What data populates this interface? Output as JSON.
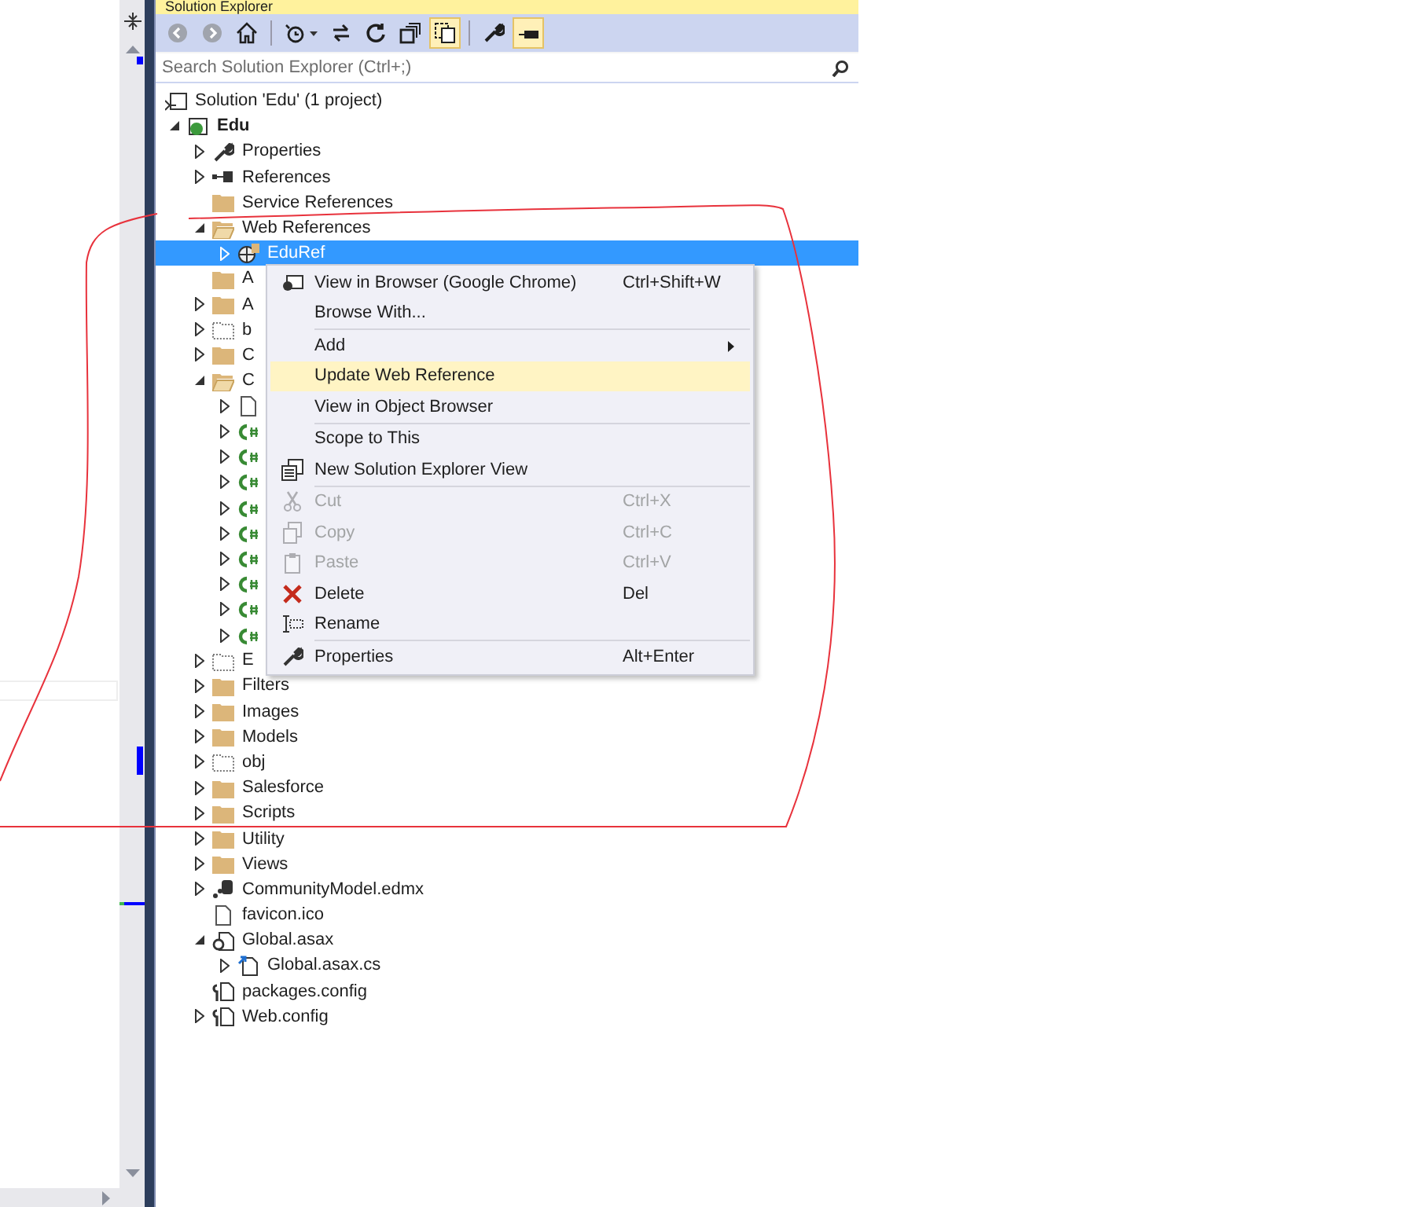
{
  "panel": {
    "title": "Solution Explorer",
    "search": {
      "placeholder": "Search Solution Explorer (Ctrl+;)"
    },
    "toolbar": [
      {
        "kind": "button",
        "disabled": true,
        "selected": false
      },
      {
        "kind": "button",
        "disabled": true,
        "selected": false
      },
      {
        "kind": "button",
        "disabled": false,
        "selected": false
      },
      {
        "kind": "separator"
      },
      {
        "kind": "button",
        "disabled": false,
        "selected": false,
        "dropdown": true
      },
      {
        "kind": "button",
        "disabled": false,
        "selected": false
      },
      {
        "kind": "button",
        "disabled": false,
        "selected": false
      },
      {
        "kind": "button",
        "disabled": false,
        "selected": false
      },
      {
        "kind": "button",
        "disabled": false,
        "selected": true
      },
      {
        "kind": "separator"
      },
      {
        "kind": "button",
        "disabled": false,
        "selected": false
      },
      {
        "kind": "button",
        "disabled": false,
        "selected": true
      }
    ],
    "tree": [
      {
        "label": "Solution 'Edu' (1 project)",
        "kind": "solution",
        "expandable": false,
        "selected": false,
        "children": [
          {
            "label": "Edu",
            "kind": "project",
            "expandable": true,
            "expanded": true,
            "selected": false,
            "children": [
              {
                "label": "Properties",
                "kind": "properties",
                "expandable": true,
                "expanded": false,
                "selected": false
              },
              {
                "label": "References",
                "kind": "references",
                "expandable": true,
                "expanded": false,
                "selected": false
              },
              {
                "label": "Service References",
                "kind": "folder",
                "expandable": false,
                "selected": false
              },
              {
                "label": "Web References",
                "kind": "folder",
                "expandable": true,
                "expanded": true,
                "selected": false,
                "children": [
                  {
                    "label": "EduRef",
                    "kind": "webref",
                    "expandable": true,
                    "expanded": false,
                    "selected": true
                  }
                ]
              },
              {
                "label": "A",
                "kind": "folder",
                "expandable": false,
                "selected": false
              },
              {
                "label": "A",
                "kind": "folder",
                "expandable": true,
                "expanded": false,
                "selected": false
              },
              {
                "label": "b",
                "kind": "excluded",
                "expandable": true,
                "expanded": false,
                "selected": false
              },
              {
                "label": "C",
                "kind": "folder",
                "expandable": true,
                "expanded": false,
                "selected": false
              },
              {
                "label": "C",
                "kind": "folder",
                "expandable": true,
                "expanded": true,
                "selected": false,
                "children": [
                  {
                    "kind": "file",
                    "expandable": true,
                    "expanded": false,
                    "selected": false
                  },
                  {
                    "kind": "csharp",
                    "expandable": true,
                    "expanded": false,
                    "selected": false
                  },
                  {
                    "kind": "csharp",
                    "expandable": true,
                    "expanded": false,
                    "selected": false
                  },
                  {
                    "kind": "csharp",
                    "expandable": true,
                    "expanded": false,
                    "selected": false
                  },
                  {
                    "kind": "csharp",
                    "expandable": true,
                    "expanded": false,
                    "selected": false
                  },
                  {
                    "kind": "csharp",
                    "expandable": true,
                    "expanded": false,
                    "selected": false
                  },
                  {
                    "kind": "csharp",
                    "expandable": true,
                    "expanded": false,
                    "selected": false
                  },
                  {
                    "kind": "csharp",
                    "expandable": true,
                    "expanded": false,
                    "selected": false
                  },
                  {
                    "kind": "csharp",
                    "expandable": true,
                    "expanded": false,
                    "selected": false
                  },
                  {
                    "kind": "csharp",
                    "expandable": true,
                    "expanded": false,
                    "selected": false
                  }
                ]
              },
              {
                "label": "E",
                "kind": "excluded",
                "expandable": true,
                "expanded": false,
                "selected": false
              },
              {
                "label": "Filters",
                "kind": "folder",
                "expandable": true,
                "expanded": false,
                "selected": false
              },
              {
                "label": "Images",
                "kind": "folder",
                "expandable": true,
                "expanded": false,
                "selected": false
              },
              {
                "label": "Models",
                "kind": "folder",
                "expandable": true,
                "expanded": false,
                "selected": false
              },
              {
                "label": "obj",
                "kind": "excluded",
                "expandable": true,
                "expanded": false,
                "selected": false
              },
              {
                "label": "Salesforce",
                "kind": "folder",
                "expandable": true,
                "expanded": false,
                "selected": false
              },
              {
                "label": "Scripts",
                "kind": "folder",
                "expandable": true,
                "expanded": false,
                "selected": false
              },
              {
                "label": "Utility",
                "kind": "folder",
                "expandable": true,
                "expanded": false,
                "selected": false
              },
              {
                "label": "Views",
                "kind": "folder",
                "expandable": true,
                "expanded": false,
                "selected": false
              },
              {
                "label": "CommunityModel.edmx",
                "kind": "edmx",
                "expandable": true,
                "expanded": false,
                "selected": false
              },
              {
                "label": "favicon.ico",
                "kind": "file",
                "expandable": false,
                "selected": false
              },
              {
                "label": "Global.asax",
                "kind": "asax",
                "expandable": true,
                "expanded": true,
                "selected": false,
                "children": [
                  {
                    "label": "Global.asax.cs",
                    "kind": "codefile",
                    "expandable": true,
                    "expanded": false,
                    "selected": false
                  }
                ]
              },
              {
                "label": "packages.config",
                "kind": "config",
                "expandable": false,
                "selected": false
              },
              {
                "label": "Web.config",
                "kind": "config",
                "expandable": true,
                "expanded": false,
                "selected": false
              }
            ]
          }
        ]
      }
    ]
  },
  "context_menu": [
    {
      "kind": "item",
      "label": "View in Browser (Google Chrome)",
      "shortcut": "Ctrl+Shift+W",
      "disabled": false,
      "selected": false,
      "submenu": false
    },
    {
      "kind": "item",
      "label": "Browse With...",
      "disabled": false,
      "selected": false,
      "submenu": false
    },
    {
      "kind": "separator"
    },
    {
      "kind": "item",
      "label": "Add",
      "disabled": false,
      "selected": false,
      "submenu": true
    },
    {
      "kind": "item",
      "label": "Update Web Reference",
      "disabled": false,
      "selected": true,
      "submenu": false
    },
    {
      "kind": "item",
      "label": "View in Object Browser",
      "disabled": false,
      "selected": false,
      "submenu": false
    },
    {
      "kind": "separator"
    },
    {
      "kind": "item",
      "label": "Scope to This",
      "disabled": false,
      "selected": false,
      "submenu": false
    },
    {
      "kind": "item",
      "label": "New Solution Explorer View",
      "disabled": false,
      "selected": false,
      "submenu": false
    },
    {
      "kind": "separator"
    },
    {
      "kind": "item",
      "label": "Cut",
      "shortcut": "Ctrl+X",
      "disabled": true,
      "selected": false,
      "submenu": false
    },
    {
      "kind": "item",
      "label": "Copy",
      "shortcut": "Ctrl+C",
      "disabled": true,
      "selected": false,
      "submenu": false
    },
    {
      "kind": "item",
      "label": "Paste",
      "shortcut": "Ctrl+V",
      "disabled": true,
      "selected": false,
      "submenu": false
    },
    {
      "kind": "item",
      "label": "Delete",
      "shortcut": "Del",
      "disabled": false,
      "selected": false,
      "submenu": false
    },
    {
      "kind": "item",
      "label": "Rename",
      "disabled": false,
      "selected": false,
      "submenu": false
    },
    {
      "kind": "separator"
    },
    {
      "kind": "item",
      "label": "Properties",
      "shortcut": "Alt+Enter",
      "disabled": false,
      "selected": false,
      "submenu": false
    }
  ]
}
